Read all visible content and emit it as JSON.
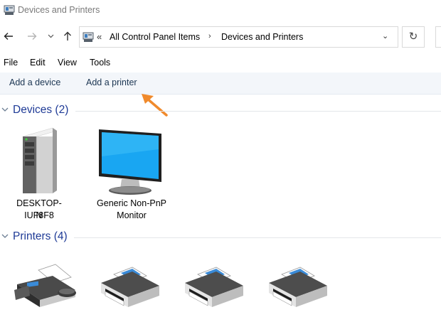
{
  "window": {
    "title": "Devices and Printers"
  },
  "nav": {
    "back_icon": "arrow-left-icon",
    "forward_icon": "arrow-right-icon",
    "recent_icon": "chevron-down-icon",
    "up_icon": "arrow-up-icon",
    "address": {
      "overflow": "«",
      "crumbs": [
        "All Control Panel Items",
        "Devices and Printers"
      ],
      "separator": "›",
      "dropdown_glyph": "⌄"
    },
    "refresh_glyph": "↻"
  },
  "menu": {
    "items": [
      "File",
      "Edit",
      "View",
      "Tools"
    ]
  },
  "commands": {
    "add_device": "Add a device",
    "add_printer": "Add a printer"
  },
  "groups": {
    "devices": {
      "title": "Devices (2)",
      "items": [
        {
          "label_line1": "DESKTOP-IUF8F8",
          "label_line2": "N",
          "icon": "computer-tower-icon"
        },
        {
          "label_line1": "Generic Non-PnP",
          "label_line2": "Monitor",
          "icon": "monitor-icon"
        }
      ]
    },
    "printers": {
      "title": "Printers (4)",
      "items": [
        {
          "icon": "fax-icon"
        },
        {
          "icon": "printer-icon"
        },
        {
          "icon": "printer-icon"
        },
        {
          "icon": "printer-icon"
        }
      ]
    }
  },
  "annotation": {
    "arrow_color": "#f08a2c"
  },
  "colors": {
    "group_title": "#1e3a96",
    "command_text": "#1b3552",
    "command_bar_bg": "#f3f6fa"
  }
}
